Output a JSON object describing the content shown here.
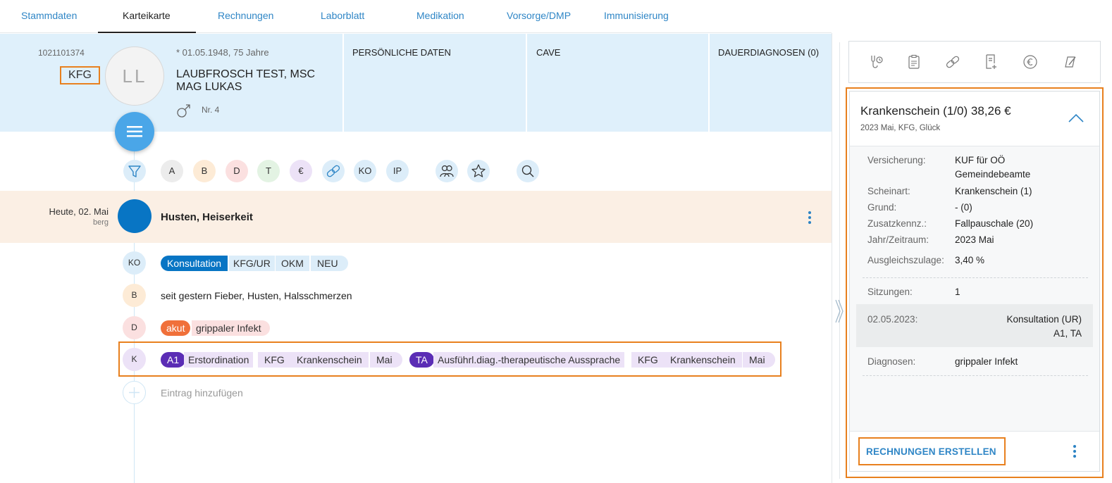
{
  "tabs": [
    {
      "label": "Stammdaten"
    },
    {
      "label": "Karteikarte"
    },
    {
      "label": "Rechnungen"
    },
    {
      "label": "Laborblatt"
    },
    {
      "label": "Medikation"
    },
    {
      "label": "Vorsorge/DMP"
    },
    {
      "label": "Immunisierung"
    }
  ],
  "active_tab": "Karteikarte",
  "patient": {
    "id": "1021101374",
    "kasse": "KFG",
    "initials": "LL",
    "birth": "* 01.05.1948, 75 Jahre",
    "name_line1": "LAUBFROSCH TEST, MSC",
    "name_line2": "MAG LUKAS",
    "nr": "Nr. 4"
  },
  "header_sections": {
    "personal": "PERSÖNLICHE DATEN",
    "cave": "CAVE",
    "diagnoses": "DAUERDIAGNOSEN (0)"
  },
  "filters": [
    "A",
    "B",
    "D",
    "T",
    "€",
    "KO",
    "IP"
  ],
  "filter_colors": {
    "A": "#ececec",
    "B": "#fdebd6",
    "D": "#fbe0e0",
    "T": "#e3f3e3",
    "€": "#ece2f7",
    "link": "#dcedf9",
    "KO": "#dcedf9",
    "IP": "#dcedf9"
  },
  "entry": {
    "date": "Heute, 02. Mai",
    "user": "berg",
    "title": "Husten, Heiserkeit",
    "ko": {
      "label": "KO",
      "chips": [
        "Konsultation",
        "KFG/UR",
        "OKM",
        "NEU"
      ]
    },
    "b": {
      "label": "B",
      "text": "seit gestern Fieber, Husten, Halsschmerzen"
    },
    "d": {
      "label": "D",
      "badge": "akut",
      "text": "grippaler Infekt"
    },
    "k": {
      "label": "K",
      "item1": {
        "code": "A1",
        "chips": [
          "Erstordination",
          "KFG",
          "Krankenschein",
          "Mai"
        ]
      },
      "item2": {
        "code": "TA",
        "chips": [
          "Ausführl.diag.-therapeutische Aussprache",
          "KFG",
          "Krankenschein",
          "Mai"
        ]
      }
    },
    "add_placeholder": "Eintrag hinzufügen"
  },
  "card": {
    "title": "Krankenschein (1/0) 38,26 €",
    "subtitle": "2023 Mai, KFG, Glück",
    "rows": [
      {
        "key": "Versicherung:",
        "value": "KUF für OÖ",
        "value2": "Gemeindebeamte"
      },
      {
        "key": "Scheinart:",
        "value": "Krankenschein (1)"
      },
      {
        "key": "Grund:",
        "value": "- (0)"
      },
      {
        "key": "Zusatzkennz.:",
        "value": "Fallpauschale (20)"
      },
      {
        "key": "Jahr/Zeitraum:",
        "value": "2023 Mai"
      },
      {
        "key": "Ausgleichszulage:",
        "value": "3,40 %"
      }
    ],
    "sessions": {
      "key": "Sitzungen:",
      "value": "1"
    },
    "session_item": {
      "date": "02.05.2023:",
      "desc": "Konsultation (UR)",
      "codes": "A1, TA"
    },
    "diagnoses": {
      "key": "Diagnosen:",
      "value": "grippaler Infekt"
    },
    "action": "RECHNUNGEN ERSTELLEN"
  },
  "colors": {
    "accent": "#2f86c6",
    "highlight": "#e8801e",
    "header_bg": "#dff0fb",
    "entry_bg": "#fbefe4",
    "purple": "#5b2db5",
    "blue_dark": "#0875c4"
  }
}
